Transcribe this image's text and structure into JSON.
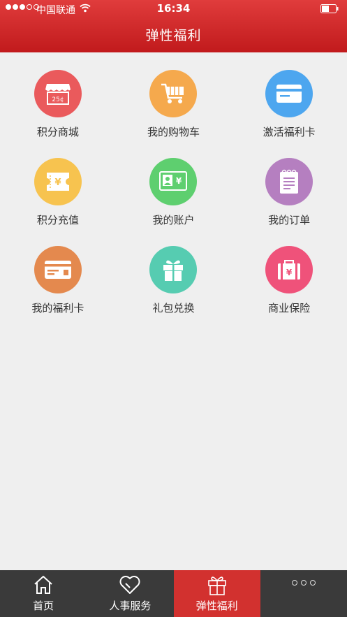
{
  "status_bar": {
    "carrier": "中国联通",
    "time": "16:34"
  },
  "header": {
    "title": "弹性福利"
  },
  "grid_items": [
    {
      "label": "积分商城",
      "icon": "store-icon",
      "color": "#ea5a5c"
    },
    {
      "label": "我的购物车",
      "icon": "shopping-cart-icon",
      "color": "#f5a94d"
    },
    {
      "label": "激活福利卡",
      "icon": "card-icon",
      "color": "#4da6ef"
    },
    {
      "label": "积分充值",
      "icon": "ticket-icon",
      "color": "#f7c34f"
    },
    {
      "label": "我的账户",
      "icon": "account-id-icon",
      "color": "#5ecf6f"
    },
    {
      "label": "我的订单",
      "icon": "order-notepad-icon",
      "color": "#b57fc0"
    },
    {
      "label": "我的福利卡",
      "icon": "welfare-card-icon",
      "color": "#e4894e"
    },
    {
      "label": "礼包兑换",
      "icon": "gift-icon",
      "color": "#56ccb1"
    },
    {
      "label": "商业保险",
      "icon": "insurance-briefcase-icon",
      "color": "#ef527a"
    }
  ],
  "tabbar": {
    "tabs": [
      {
        "label": "首页",
        "icon": "home-icon",
        "active": false
      },
      {
        "label": "人事服务",
        "icon": "heart-icon",
        "active": false
      },
      {
        "label": "弹性福利",
        "icon": "gift-icon",
        "active": true
      },
      {
        "label": "",
        "icon": "more-icon",
        "active": false
      }
    ],
    "active_color": "#d2312f"
  }
}
